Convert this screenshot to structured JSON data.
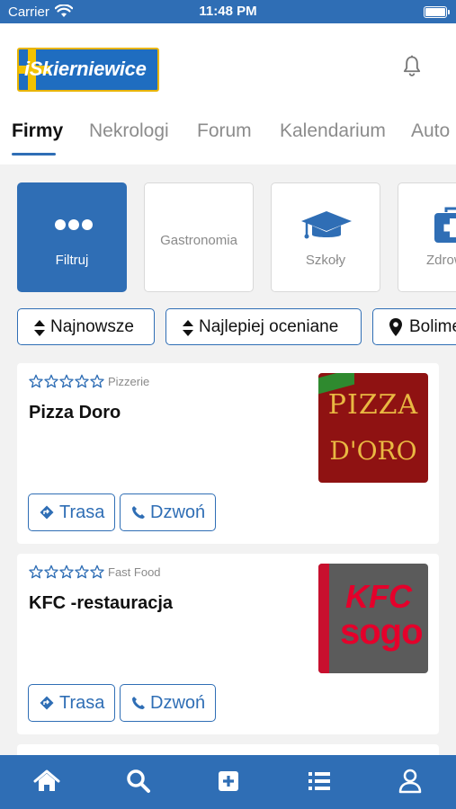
{
  "status_bar": {
    "carrier": "Carrier",
    "time": "11:48 PM"
  },
  "header": {
    "logo_text": "iSkierniewice"
  },
  "tabs": [
    {
      "label": "Firmy",
      "active": true
    },
    {
      "label": "Nekrologi",
      "active": false
    },
    {
      "label": "Forum",
      "active": false
    },
    {
      "label": "Kalendarium",
      "active": false
    },
    {
      "label": "Auto",
      "active": false
    }
  ],
  "categories": [
    {
      "label": "Filtruj",
      "icon": "more-dots-icon",
      "active": true
    },
    {
      "label": "Gastronomia",
      "icon": "",
      "active": false
    },
    {
      "label": "Szkoły",
      "icon": "graduation-cap-icon",
      "active": false
    },
    {
      "label": "Zdrow",
      "icon": "medical-kit-icon",
      "active": false
    }
  ],
  "sort_chips": [
    {
      "label": "Najnowsze",
      "icon": "sort-icon"
    },
    {
      "label": "Najlepiej oceniane",
      "icon": "sort-icon"
    },
    {
      "label": "Bolime",
      "icon": "map-pin-icon"
    }
  ],
  "listings": [
    {
      "name": "Pizza Doro",
      "category": "Pizzerie",
      "rating": 0,
      "max_rating": 5,
      "image_text_top": "PIZZA",
      "image_text_bottom": "D'ORO",
      "route_label": "Trasa",
      "call_label": "Dzwoń"
    },
    {
      "name": "KFC -restauracja",
      "category": "Fast Food",
      "rating": 0,
      "max_rating": 5,
      "image_text_top": "KFC",
      "image_text_bottom": "sogo",
      "route_label": "Trasa",
      "call_label": "Dzwoń"
    }
  ],
  "bottom_nav": [
    {
      "icon": "home-icon"
    },
    {
      "icon": "search-icon"
    },
    {
      "icon": "add-icon"
    },
    {
      "icon": "list-icon"
    },
    {
      "icon": "profile-icon"
    }
  ],
  "colors": {
    "primary": "#2f6eb5",
    "muted_text": "#8a8a8a",
    "background": "#f2f2f2"
  }
}
